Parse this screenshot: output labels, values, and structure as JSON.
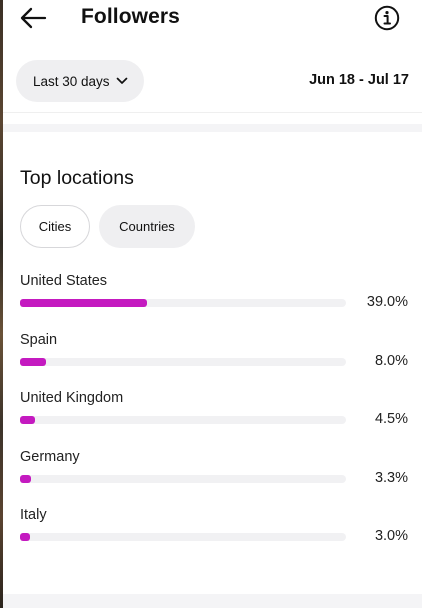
{
  "header": {
    "title": "Followers",
    "back_icon": "arrow-left-icon",
    "info_icon": "info-circle-icon"
  },
  "filter": {
    "range_label": "Last 30 days",
    "range_icon": "chevron-down-icon",
    "date_range": "Jun 18 - Jul 17"
  },
  "locations": {
    "title": "Top locations",
    "tabs": [
      {
        "label": "Cities",
        "selected": true
      },
      {
        "label": "Countries",
        "selected": false
      }
    ],
    "bar_color": "#c41ac0",
    "items": [
      {
        "name": "United States",
        "percent_label": "39.0%",
        "value": 39.0
      },
      {
        "name": "Spain",
        "percent_label": "8.0%",
        "value": 8.0
      },
      {
        "name": "United Kingdom",
        "percent_label": "4.5%",
        "value": 4.5
      },
      {
        "name": "Germany",
        "percent_label": "3.3%",
        "value": 3.3
      },
      {
        "name": "Italy",
        "percent_label": "3.0%",
        "value": 3.0
      }
    ]
  }
}
